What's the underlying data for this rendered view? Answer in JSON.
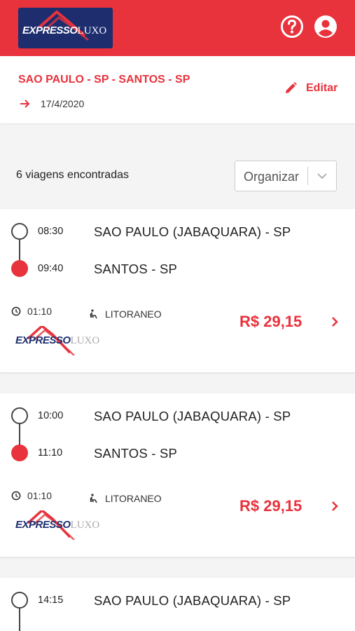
{
  "header": {
    "brand_main": "EXPRESSO",
    "brand_sub": "LUXO",
    "help_icon": "help-circle-icon",
    "account_icon": "account-circle-icon",
    "color": "#e8323c"
  },
  "route": {
    "title": "SAO PAULO - SP - SANTOS - SP",
    "date": "17/4/2020",
    "edit_label": "Editar"
  },
  "results": {
    "count_label": "6 viagens encontradas",
    "sort_placeholder": "Organizar"
  },
  "trips": [
    {
      "depart_time": "08:30",
      "origin": "SAO PAULO (JABAQUARA) - SP",
      "arrive_time": "09:40",
      "destination": "SANTOS - SP",
      "duration": "01:10",
      "service": "LITORANEO",
      "price": "R$ 29,15",
      "company_main": "EXPRESSO",
      "company_sub": "LUXO"
    },
    {
      "depart_time": "10:00",
      "origin": "SAO PAULO (JABAQUARA) - SP",
      "arrive_time": "11:10",
      "destination": "SANTOS - SP",
      "duration": "01:10",
      "service": "LITORANEO",
      "price": "R$ 29,15",
      "company_main": "EXPRESSO",
      "company_sub": "LUXO"
    },
    {
      "depart_time": "14:15",
      "origin": "SAO PAULO (JABAQUARA) - SP"
    }
  ]
}
